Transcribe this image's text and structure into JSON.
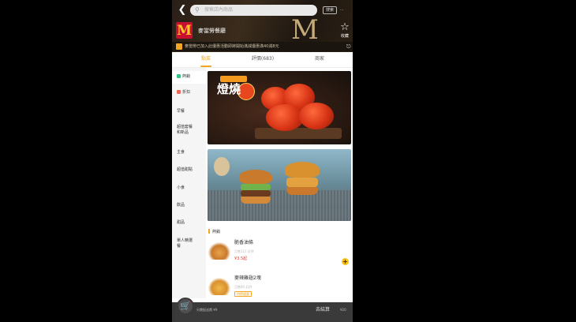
{
  "header": {
    "back_icon": "chevron-left-icon",
    "search_placeholder": "搜索店內商品",
    "search_button": "搜索",
    "extra": "···",
    "store_name": "麥當勞餐廳",
    "fav_label": "收藏",
    "notice": "麥當勞已加入此優惠活動即將開始滿減優惠滿40減8元"
  },
  "tabs": [
    {
      "label": "點菜",
      "active": true
    },
    {
      "label": "評價(683)",
      "active": false
    },
    {
      "label": "商家",
      "active": false
    }
  ],
  "sidebar": [
    {
      "label": "熱銷",
      "active": true,
      "icon": "fire-icon",
      "color": "#39c28a"
    },
    {
      "label": "折扣",
      "active": false,
      "icon": "discount-icon",
      "color": "#f06a5a"
    },
    {
      "label": "早餐",
      "active": false
    },
    {
      "label": "超值套餐",
      "active": false,
      "label2": "和新品"
    },
    {
      "label": "主食",
      "active": false
    },
    {
      "label": "超值甜點",
      "active": false
    },
    {
      "label": "小食",
      "active": false
    },
    {
      "label": "飲品",
      "active": false
    },
    {
      "label": "甜品",
      "active": false
    },
    {
      "label": "單人精選",
      "active": false,
      "label2": "餐"
    }
  ],
  "banners": [
    {
      "title": "燈燒",
      "theme": "spicy-chicken"
    },
    {
      "title": "",
      "theme": "burgers"
    }
  ],
  "section": {
    "title": "熱銷"
  },
  "items": [
    {
      "name": "脆香油條",
      "meta": "月售121  好評",
      "price": "¥3.5起"
    },
    {
      "name": "麥辣雞翅2塊",
      "meta": "月售80  好評",
      "tag": "特價優惠"
    }
  ],
  "cart": {
    "icon": "cart-icon",
    "text": "另需配送費 ¥9",
    "checkout": "去結算",
    "checkout_extra": "¥20"
  },
  "colors": {
    "accent": "#f2a623",
    "price": "#e53935",
    "logo_red": "#c8102e",
    "logo_yellow": "#ffc72c"
  }
}
